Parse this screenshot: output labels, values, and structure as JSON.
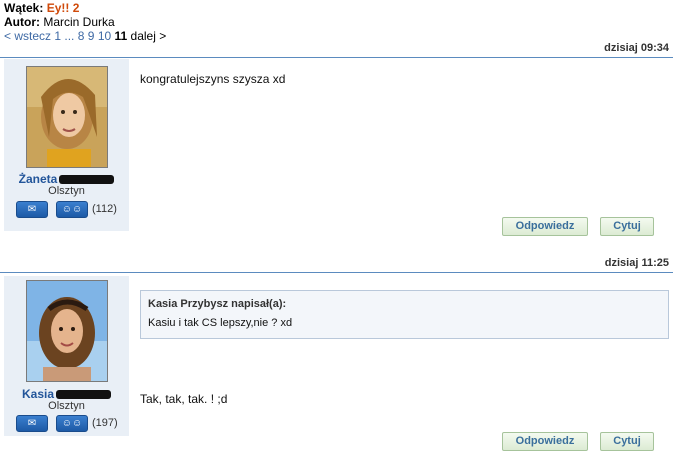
{
  "thread": {
    "title_label": "Wątek:",
    "title": "Ey!! 2",
    "author_label": "Autor:",
    "author": "Marcin Durka"
  },
  "pager": {
    "prev": "< wstecz",
    "first": "1",
    "ellipsis": "...",
    "p8": "8",
    "p9": "9",
    "p10": "10",
    "current": "11",
    "next": "dalej >"
  },
  "posts": [
    {
      "date": "dzisiaj 09:34",
      "user": "Żaneta",
      "city": "Olsztyn",
      "count": "(112)",
      "text": "kongratulejszyns szysza xd",
      "reply_label": "Odpowiedz",
      "quote_label": "Cytuj"
    },
    {
      "date": "dzisiaj 11:25",
      "user": "Kasia",
      "city": "Olsztyn",
      "count": "(197)",
      "quote_author": "Kasia Przybysz napisał(a):",
      "quote_text": "Kasiu i tak CS lepszy,nie ? xd",
      "text": "Tak, tak, tak. ! ;d",
      "reply_label": "Odpowiedz",
      "quote_label": "Cytuj"
    }
  ],
  "icons": [
    "mail-icon",
    "people-icon"
  ]
}
